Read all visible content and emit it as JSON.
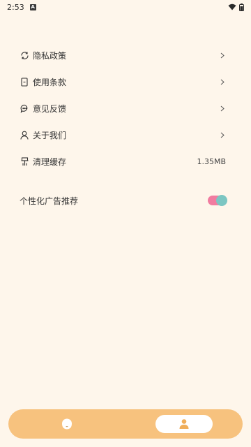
{
  "status_bar": {
    "time": "2:53",
    "notification_icon": "A",
    "icons": [
      "wifi-icon",
      "battery-icon"
    ]
  },
  "menu": {
    "items": [
      {
        "label": "隐私政策",
        "icon": "sync-icon",
        "has_chevron": true
      },
      {
        "label": "使用条款",
        "icon": "document-icon",
        "has_chevron": true
      },
      {
        "label": "意见反馈",
        "icon": "chat-icon",
        "has_chevron": true
      },
      {
        "label": "关于我们",
        "icon": "person-icon",
        "has_chevron": true
      },
      {
        "label": "清理缓存",
        "icon": "broom-icon",
        "value": "1.35MB"
      }
    ]
  },
  "ad_toggle": {
    "label": "个性化广告推荐",
    "enabled": true
  },
  "bottom_nav": {
    "tabs": [
      {
        "name": "home",
        "icon": "home-blob-icon",
        "active": false
      },
      {
        "name": "mine",
        "icon": "person-filled-icon",
        "active": true
      }
    ]
  },
  "colors": {
    "background": "#FEF6EB",
    "nav_background": "#F7C27E",
    "toggle_track": "#F17CA0",
    "toggle_knob": "#7CC6C2"
  }
}
